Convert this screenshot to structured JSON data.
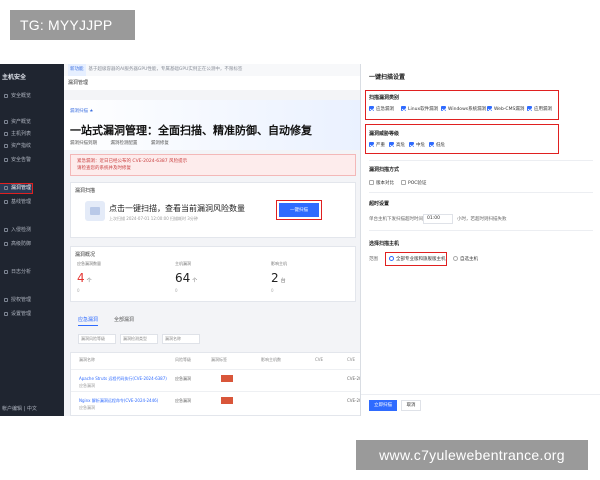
{
  "top_tag": "TG: MYYJJPP",
  "url_tag": "www.c7yulewebentrance.org",
  "sidebar": {
    "brand": "主机安全",
    "items": [
      "安全概览",
      "资产概览",
      "主机列表",
      "资产指纹",
      "安全告警",
      "漏洞管理",
      "基线管理",
      "入侵检测",
      "高级防御",
      "日志分析",
      "授权管理",
      "设置管理"
    ],
    "footer": "帐户编辑 | 中文"
  },
  "notice": {
    "pill": "新功能",
    "text": "基于超级容器的AI服务器GPU性能，专属基础GPU实例正在公测中，不限标签"
  },
  "page_header": "漏洞管理",
  "hero": {
    "sub": "漏洞扫描 ★",
    "title": "一站式漏洞管理：全面扫描、精准防御、自动修复",
    "chips": [
      "漏洞扫描到期",
      "漏洞检测配置",
      "漏洞修复"
    ]
  },
  "alert": {
    "line1": "紧急漏洞：近日已经公布的 CVE-2024-6387 风险提示",
    "line2": "请检查您的系统并及时修复"
  },
  "scan_card": {
    "label": "漏洞扫描",
    "title": "点击一键扫描，查看当前漏洞风险数量",
    "meta": "上次扫描 2024-07-01 12:00:00   扫描耗时 3分钟",
    "button": "一键扫描"
  },
  "overview": {
    "label": "漏洞概况",
    "cols": [
      {
        "name": "应急漏洞数量",
        "value": "4",
        "unit": "个",
        "foot": "0"
      },
      {
        "name": "主机漏洞",
        "value": "64",
        "unit": "个",
        "foot": "0"
      },
      {
        "name": "影响主机",
        "value": "2",
        "unit": "台",
        "foot": "0"
      }
    ]
  },
  "tabs": [
    "应急漏洞",
    "全部漏洞"
  ],
  "filters": [
    "漏洞风险等级",
    "漏洞检测类型",
    "漏洞名称"
  ],
  "table": {
    "headers": [
      "漏洞名称",
      "风险等级",
      "漏洞标签",
      "影响主机数",
      "CVE",
      "CVE"
    ],
    "rows": [
      {
        "name": "Apache Struts 远程代码执行",
        "cve_label": "(CVE-2024-6387)",
        "sub": "应急漏洞",
        "tag": "重要",
        "cve": "CVE-20"
      },
      {
        "name": "Nginx 解析漏洞远程命令",
        "cve_label": "(CVE-2024-2446)",
        "sub": "应急漏洞",
        "tag": "重要",
        "cve": "CVE-20"
      }
    ]
  },
  "drawer": {
    "title": "一键扫描设置",
    "scan_type_label": "扫描漏洞类别",
    "scan_types": [
      "应急漏洞",
      "Linux软件漏洞",
      "Windows系统漏洞",
      "Web-CMS漏洞",
      "应用漏洞"
    ],
    "level_label": "漏洞威胁等级",
    "levels": [
      "严重",
      "高危",
      "中危",
      "低危"
    ],
    "method_label": "漏洞扫描方式",
    "methods": [
      "版本对比",
      "POC验证"
    ],
    "timeout_label": "超时设置",
    "timeout_prefix": "单台主机下发扫描超时时间",
    "timeout_value": "01:00",
    "timeout_suffix": "小时，若超时则扫描失败",
    "host_label": "选择扫描主机",
    "host_range_label": "范围",
    "host_options": [
      "全部专业版和旗舰版主机",
      "自选主机"
    ],
    "ok": "立即扫描",
    "cancel": "取消"
  }
}
